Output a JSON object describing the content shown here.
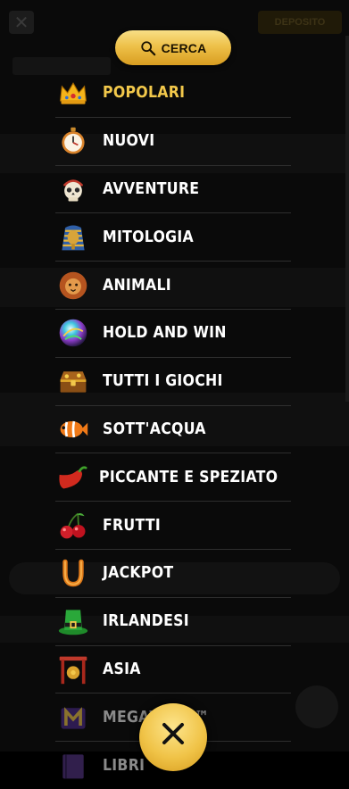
{
  "search": {
    "label": "CERCA",
    "icon": "search-icon"
  },
  "background": {
    "deposit_label": "DEPOSITO"
  },
  "menu": {
    "items": [
      {
        "label": "POPOLARI",
        "icon": "crown-icon",
        "active": true
      },
      {
        "label": "NUOVI",
        "icon": "stopwatch-icon"
      },
      {
        "label": "AVVENTURE",
        "icon": "pirate-skull-icon"
      },
      {
        "label": "MITOLOGIA",
        "icon": "pharaoh-icon"
      },
      {
        "label": "ANIMALI",
        "icon": "lion-icon"
      },
      {
        "label": "HOLD AND WIN",
        "icon": "orb-icon"
      },
      {
        "label": "TUTTI I GIOCHI",
        "icon": "treasure-chest-icon"
      },
      {
        "label": "SOTT'ACQUA",
        "icon": "clownfish-icon"
      },
      {
        "label": "PICCANTE E SPEZIATO",
        "icon": "chili-pepper-icon"
      },
      {
        "label": "FRUTTI",
        "icon": "cherries-icon"
      },
      {
        "label": "JACKPOT",
        "icon": "horseshoe-icon"
      },
      {
        "label": "IRLANDESI",
        "icon": "leprechaun-hat-icon"
      },
      {
        "label": "ASIA",
        "icon": "gong-icon"
      },
      {
        "label": "MEGAWAYS™",
        "icon": "megaways-m-icon",
        "faded": true
      },
      {
        "label": "LIBRI",
        "icon": "book-icon",
        "faded": true
      }
    ]
  },
  "close": {
    "icon": "close-icon"
  },
  "colors": {
    "accent": "#f2c84b",
    "gold_button": "#eec14a",
    "divider": "#2e2e2e",
    "text": "#ffffff"
  }
}
